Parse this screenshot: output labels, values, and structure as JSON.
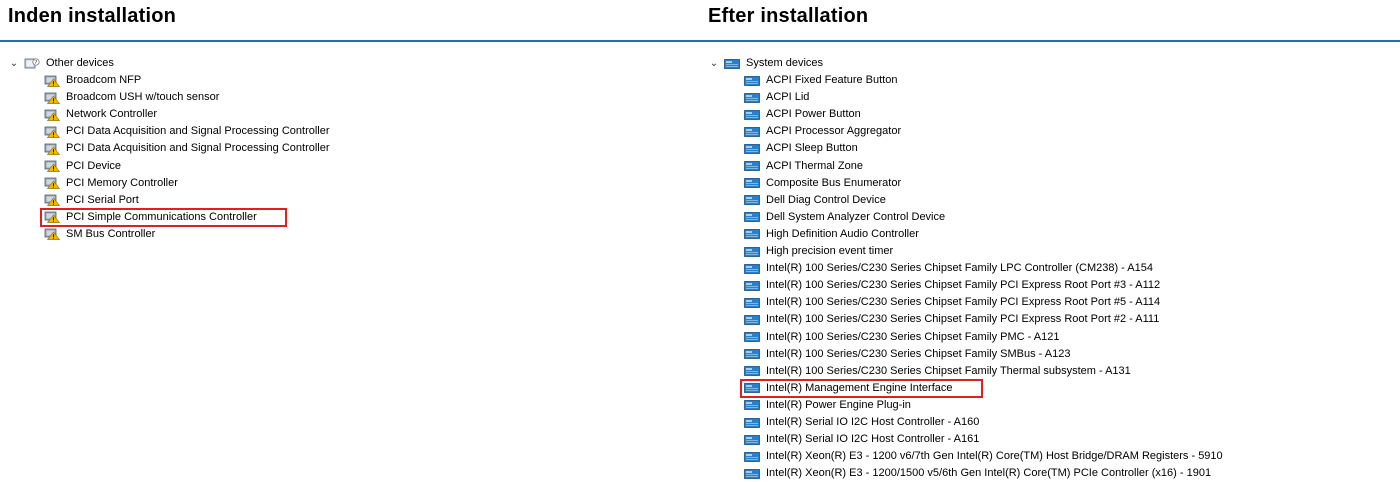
{
  "headings": {
    "left": "Inden installation",
    "right": "Efter installation"
  },
  "accent_color": "#1f6fb2",
  "highlight_color": "#e02020",
  "left_tree": {
    "category": "Other devices",
    "category_icon": "unknown-device-icon",
    "expand_icon": "chevron-down-icon",
    "item_icon": "warning-device-icon",
    "items": [
      "Broadcom NFP",
      "Broadcom USH w/touch sensor",
      "Network Controller",
      "PCI Data Acquisition and Signal Processing Controller",
      "PCI Data Acquisition and Signal Processing Controller",
      "PCI Device",
      "PCI Memory Controller",
      "PCI Serial Port",
      "PCI Simple Communications Controller",
      "SM Bus Controller"
    ],
    "highlighted_item": "PCI Simple Communications Controller"
  },
  "right_tree": {
    "category": "System devices",
    "category_icon": "system-folder-icon",
    "expand_icon": "chevron-down-icon",
    "item_icon": "system-device-icon",
    "items": [
      "ACPI Fixed Feature Button",
      "ACPI Lid",
      "ACPI Power Button",
      "ACPI Processor Aggregator",
      "ACPI Sleep Button",
      "ACPI Thermal Zone",
      "Composite Bus Enumerator",
      "Dell Diag Control Device",
      "Dell System Analyzer Control Device",
      "High Definition Audio Controller",
      "High precision event timer",
      "Intel(R) 100 Series/C230 Series Chipset Family LPC Controller (CM238) - A154",
      "Intel(R) 100 Series/C230 Series Chipset Family PCI Express Root Port #3 - A112",
      "Intel(R) 100 Series/C230 Series Chipset Family PCI Express Root Port #5 - A114",
      "Intel(R) 100 Series/C230 Series Chipset Family PCI Express Root Port #2 - A111",
      "Intel(R) 100 Series/C230 Series Chipset Family PMC - A121",
      "Intel(R) 100 Series/C230 Series Chipset Family SMBus - A123",
      "Intel(R) 100 Series/C230 Series Chipset Family Thermal subsystem - A131",
      "Intel(R) Management Engine Interface",
      "Intel(R) Power Engine Plug-in",
      "Intel(R) Serial IO I2C Host Controller - A160",
      "Intel(R) Serial IO I2C Host Controller - A161",
      "Intel(R) Xeon(R) E3 - 1200 v6/7th Gen Intel(R) Core(TM) Host Bridge/DRAM Registers - 5910",
      "Intel(R) Xeon(R) E3 - 1200/1500 v5/6th Gen Intel(R) Core(TM) PCIe Controller (x16) - 1901"
    ],
    "highlighted_item": "Intel(R) Management Engine Interface"
  }
}
